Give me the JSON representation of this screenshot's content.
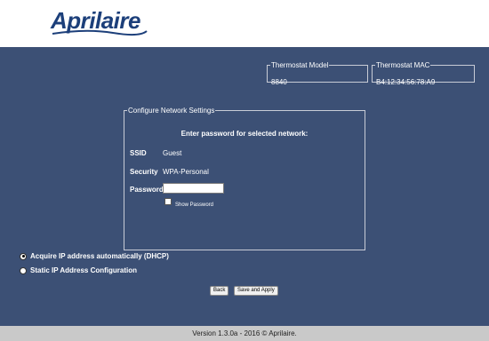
{
  "brand": {
    "name": "Aprilaire",
    "color": "#1c3f7a"
  },
  "thermostat": {
    "model_label": "Thermostat Model",
    "model_value": "8840",
    "mac_label": "Thermostat MAC",
    "mac_value": "B4:12:34:56:78:A9"
  },
  "network": {
    "legend": "Configure Network Settings",
    "prompt": "Enter password for selected network:",
    "ssid_label": "SSID",
    "ssid_value": "Guest",
    "security_label": "Security",
    "security_value": "WPA-Personal",
    "password_label": "Password",
    "password_value": "",
    "show_password_label": "Show Password",
    "show_password_checked": false
  },
  "ip_config": {
    "options": [
      {
        "label": "Acquire IP address automatically (DHCP)",
        "selected": true
      },
      {
        "label": "Static IP Address Configuration",
        "selected": false
      }
    ]
  },
  "buttons": {
    "back": "Back",
    "save_apply": "Save and Apply"
  },
  "footer": {
    "text": "Version 1.3.0a - 2016 © Aprilaire."
  },
  "colors": {
    "panel_bg": "#3c5075",
    "footer_bg": "#c9c9c9"
  }
}
